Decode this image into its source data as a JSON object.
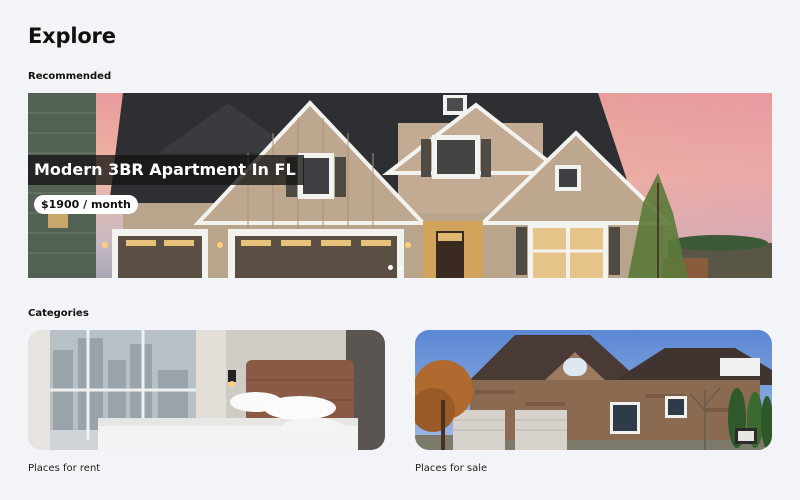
{
  "header": {
    "title": "Explore"
  },
  "recommended": {
    "section_label": "Recommended",
    "featured": {
      "title": "Modern 3BR Apartment In FL",
      "price": "$1900 / month",
      "image": "suburban-house-photo",
      "carousel": {
        "count": 2,
        "active_index": 0
      }
    }
  },
  "categories": {
    "section_label": "Categories",
    "items": [
      {
        "label": "Places for rent",
        "image": "bedroom-photo"
      },
      {
        "label": "Places for sale",
        "image": "brick-house-photo"
      }
    ]
  },
  "colors": {
    "background": "#f3f4f7",
    "title_bg": "#141414",
    "price_bg": "#ffffff"
  }
}
